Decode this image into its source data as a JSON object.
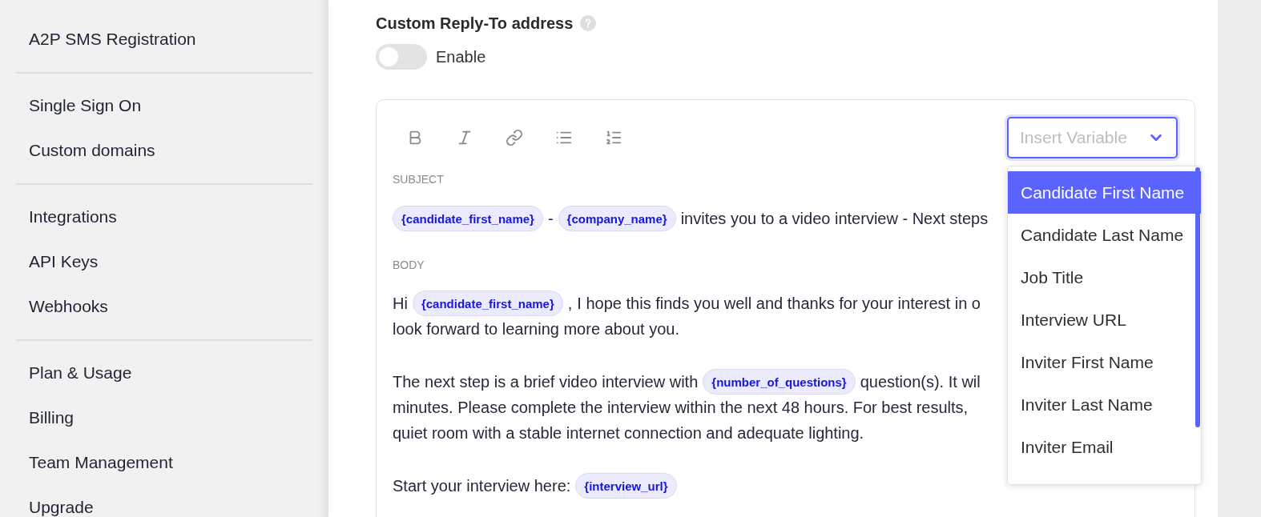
{
  "sidebar": {
    "groups": [
      {
        "items": [
          {
            "label": "A2P SMS Registration"
          }
        ]
      },
      {
        "items": [
          {
            "label": "Single Sign On"
          },
          {
            "label": "Custom domains"
          }
        ]
      },
      {
        "items": [
          {
            "label": "Integrations"
          },
          {
            "label": "API Keys"
          },
          {
            "label": "Webhooks"
          }
        ]
      },
      {
        "items": [
          {
            "label": "Plan & Usage"
          },
          {
            "label": "Billing"
          },
          {
            "label": "Team Management"
          },
          {
            "label": "Upgrade"
          }
        ]
      }
    ]
  },
  "reply_to": {
    "title": "Custom Reply-To address",
    "toggle": {
      "label": "Enable",
      "on": false
    }
  },
  "insert_variable": {
    "placeholder": "Insert Variable",
    "expanded": true,
    "options": [
      {
        "label": "Candidate First Name",
        "selected": true
      },
      {
        "label": "Candidate Last Name",
        "selected": false
      },
      {
        "label": "Job Title",
        "selected": false
      },
      {
        "label": "Interview URL",
        "selected": false
      },
      {
        "label": "Inviter First Name",
        "selected": false
      },
      {
        "label": "Inviter Last Name",
        "selected": false
      },
      {
        "label": "Inviter Email",
        "selected": false
      }
    ]
  },
  "subject": {
    "label": "SUBJECT",
    "segments": [
      {
        "kind": "variable",
        "text": "{candidate_first_name}"
      },
      {
        "kind": "text",
        "text": "-"
      },
      {
        "kind": "variable",
        "text": "{company_name}"
      },
      {
        "kind": "text",
        "text": "invites you to a video interview - Next steps"
      }
    ]
  },
  "body": {
    "label": "BODY",
    "paragraphs": [
      {
        "lines": [
          [
            {
              "kind": "text",
              "text": "Hi"
            },
            {
              "kind": "variable",
              "text": "{candidate_first_name}"
            },
            {
              "kind": "text",
              "text": ","
            },
            {
              "kind": "text",
              "text": "I hope this finds you well and thanks for your interest in o"
            }
          ],
          [
            {
              "kind": "text",
              "text": "look forward to learning more about you."
            }
          ]
        ]
      },
      {
        "lines": [
          [
            {
              "kind": "text",
              "text": "The next step is a brief video interview with"
            },
            {
              "kind": "variable",
              "text": "{number_of_questions}"
            },
            {
              "kind": "text",
              "text": "question(s). It wil"
            }
          ],
          [
            {
              "kind": "text",
              "text": "minutes. Please complete the interview within the next 48 hours. For best results,"
            }
          ],
          [
            {
              "kind": "text",
              "text": "quiet room with a stable internet connection and adequate lighting."
            }
          ]
        ]
      },
      {
        "lines": [
          [
            {
              "kind": "text",
              "text": "Start your interview here:"
            },
            {
              "kind": "variable",
              "text": "{interview_url}"
            }
          ]
        ]
      }
    ]
  }
}
